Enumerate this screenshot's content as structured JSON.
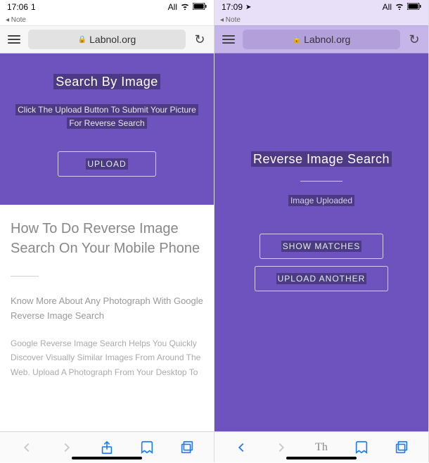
{
  "left": {
    "status": {
      "time": "17:06",
      "signal": "1",
      "carrier": "All"
    },
    "note": "◂ Note",
    "address": "Labnol.org",
    "hero": {
      "title": "Search By Image",
      "subtitle_1": "Click The Upload Button To Submit Your Picture",
      "subtitle_2": "For Reverse Search",
      "upload_btn": "UPLOAD"
    },
    "article": {
      "headline": "How To Do Reverse Image Search On Your Mobile Phone",
      "lead_1": "Know More About Any Photograph With Google",
      "lead_2": "Reverse Image Search",
      "body": "Google Reverse Image Search Helps You Quickly Discover Visually Similar Images From Around The Web. Upload A Photograph From Your Desktop To"
    }
  },
  "right": {
    "status": {
      "time": "17:09",
      "carrier": "All"
    },
    "note": "◂ Note",
    "address": "Labnol.org",
    "hero": {
      "title": "Reverse Image Search",
      "status_text": "Image Uploaded",
      "show_btn": "SHOW MATCHES",
      "another_btn": "UPLOAD ANOTHER"
    },
    "reader": "Th"
  }
}
